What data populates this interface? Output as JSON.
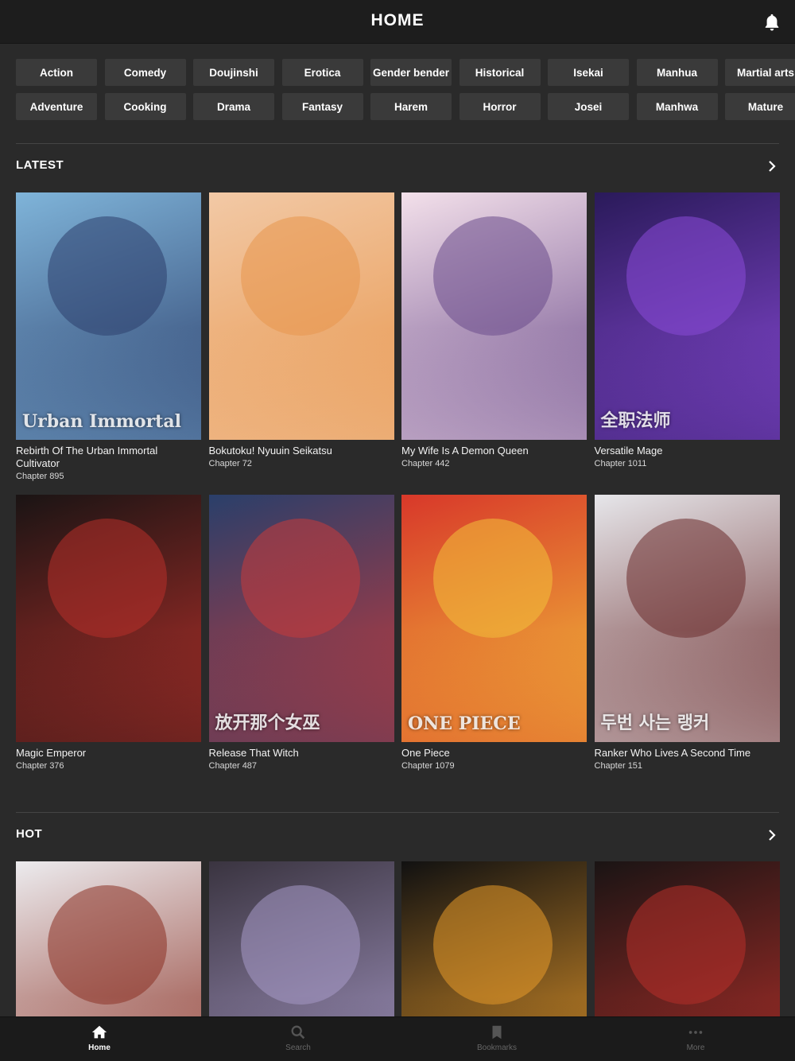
{
  "header": {
    "title": "HOME",
    "bell_icon": "bell-icon"
  },
  "genres": {
    "row1": [
      "Action",
      "Comedy",
      "Doujinshi",
      "Erotica",
      "Gender bender",
      "Historical",
      "Isekai",
      "Manhua",
      "Martial arts"
    ],
    "row2": [
      "Adventure",
      "Cooking",
      "Drama",
      "Fantasy",
      "Harem",
      "Horror",
      "Josei",
      "Manhwa",
      "Mature"
    ]
  },
  "latest": {
    "label": "LATEST",
    "items": [
      {
        "name": "Rebirth Of The Urban Immortal Cultivator",
        "chapter": "Chapter 895",
        "cover_text": "Urban Immortal",
        "colors": [
          "#7fb4d9",
          "#2c3e6b"
        ]
      },
      {
        "name": "Bokutoku! Nyuuin Seikatsu",
        "chapter": "Chapter 72",
        "cover_text": "",
        "colors": [
          "#f2c9a6",
          "#e8964c"
        ]
      },
      {
        "name": "My Wife Is A Demon Queen",
        "chapter": "Chapter 442",
        "cover_text": "",
        "colors": [
          "#f3e0ea",
          "#6a4a8a"
        ]
      },
      {
        "name": "Versatile Mage",
        "chapter": "Chapter 1011",
        "cover_text": "全职法师",
        "colors": [
          "#2a1a5a",
          "#8a4ad8"
        ]
      },
      {
        "name": "Magic Emperor",
        "chapter": "Chapter 376",
        "cover_text": "",
        "colors": [
          "#1a1414",
          "#b8302a"
        ]
      },
      {
        "name": "Release That Witch",
        "chapter": "Chapter 487",
        "cover_text": "放开那个女巫",
        "colors": [
          "#2a3f6a",
          "#c83a3a"
        ]
      },
      {
        "name": "One Piece",
        "chapter": "Chapter 1079",
        "cover_text": "ONE PIECE",
        "colors": [
          "#d8382a",
          "#f2c13a"
        ]
      },
      {
        "name": "Ranker Who Lives A Second Time",
        "chapter": "Chapter 151",
        "cover_text": "두번 사는 랭커",
        "colors": [
          "#e6e6ea",
          "#6a2a2a"
        ]
      }
    ]
  },
  "hot": {
    "label": "HOT",
    "items": [
      {
        "colors": [
          "#ecebee",
          "#8a2f22"
        ]
      },
      {
        "colors": [
          "#3a3440",
          "#a89ac8"
        ]
      },
      {
        "colors": [
          "#111111",
          "#e89a2a"
        ]
      },
      {
        "colors": [
          "#1a1414",
          "#b8302a"
        ]
      }
    ]
  },
  "tabbar": {
    "tabs": [
      {
        "label": "Home",
        "icon": "home-icon"
      },
      {
        "label": "Search",
        "icon": "search-icon"
      },
      {
        "label": "Bookmarks",
        "icon": "bookmark-icon"
      },
      {
        "label": "More",
        "icon": "more-icon"
      }
    ]
  }
}
